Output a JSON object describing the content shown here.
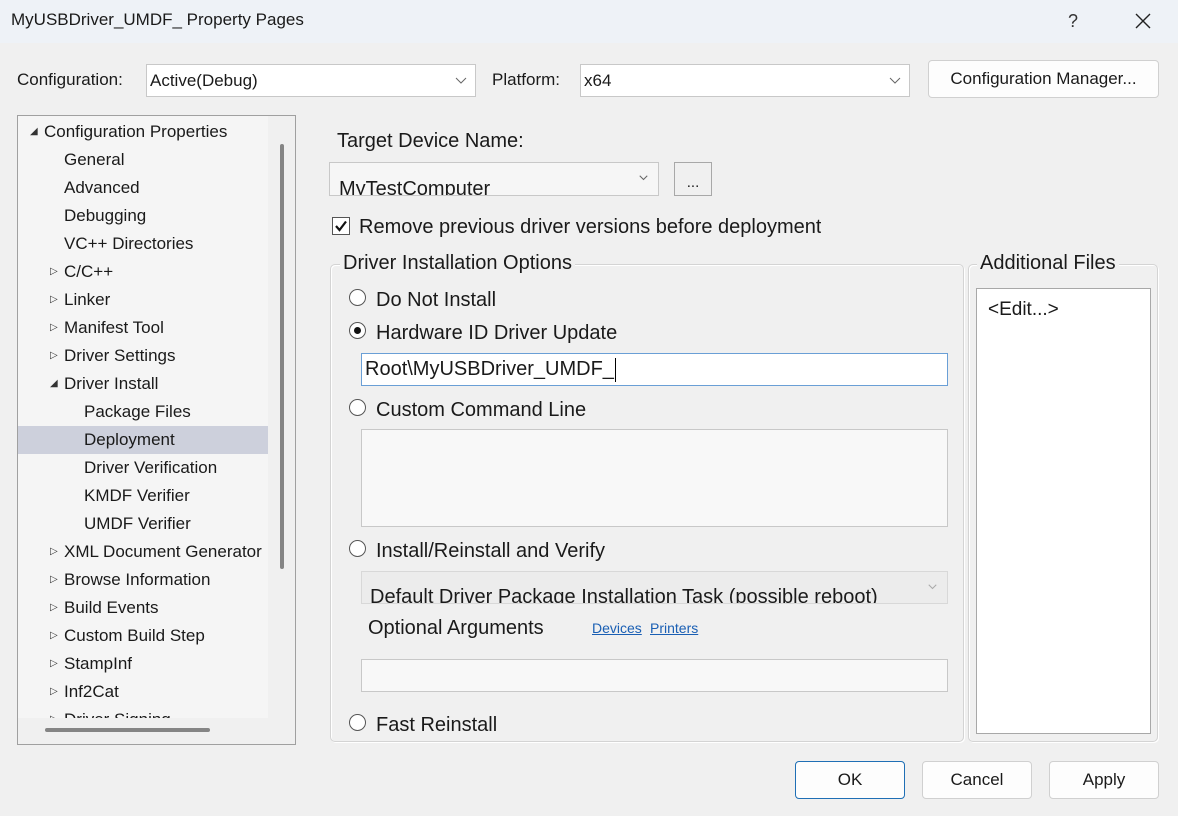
{
  "window": {
    "title": "MyUSBDriver_UMDF_ Property Pages",
    "help_label": "?"
  },
  "config_bar": {
    "configuration_label": "Configuration:",
    "configuration_value": "Active(Debug)",
    "platform_label": "Platform:",
    "platform_value": "x64",
    "config_manager_label": "Configuration Manager..."
  },
  "tree": {
    "items": [
      {
        "label": "Configuration Properties",
        "level": 0,
        "expander": "expanded"
      },
      {
        "label": "General",
        "level": 1,
        "expander": "none"
      },
      {
        "label": "Advanced",
        "level": 1,
        "expander": "none"
      },
      {
        "label": "Debugging",
        "level": 1,
        "expander": "none"
      },
      {
        "label": "VC++ Directories",
        "level": 1,
        "expander": "none"
      },
      {
        "label": "C/C++",
        "level": 1,
        "expander": "collapsed"
      },
      {
        "label": "Linker",
        "level": 1,
        "expander": "collapsed"
      },
      {
        "label": "Manifest Tool",
        "level": 1,
        "expander": "collapsed"
      },
      {
        "label": "Driver Settings",
        "level": 1,
        "expander": "collapsed"
      },
      {
        "label": "Driver Install",
        "level": 1,
        "expander": "expanded"
      },
      {
        "label": "Package Files",
        "level": 2,
        "expander": "none"
      },
      {
        "label": "Deployment",
        "level": 2,
        "expander": "none",
        "selected": true
      },
      {
        "label": "Driver Verification",
        "level": 2,
        "expander": "none"
      },
      {
        "label": "KMDF Verifier",
        "level": 2,
        "expander": "none"
      },
      {
        "label": "UMDF Verifier",
        "level": 2,
        "expander": "none"
      },
      {
        "label": "XML Document Generator",
        "level": 1,
        "expander": "collapsed"
      },
      {
        "label": "Browse Information",
        "level": 1,
        "expander": "collapsed"
      },
      {
        "label": "Build Events",
        "level": 1,
        "expander": "collapsed"
      },
      {
        "label": "Custom Build Step",
        "level": 1,
        "expander": "collapsed"
      },
      {
        "label": "StampInf",
        "level": 1,
        "expander": "collapsed"
      },
      {
        "label": "Inf2Cat",
        "level": 1,
        "expander": "collapsed"
      },
      {
        "label": "Driver Signing",
        "level": 1,
        "expander": "collapsed"
      }
    ]
  },
  "deployment": {
    "target_device_label": "Target Device Name:",
    "target_device_value": "MyTestComputer",
    "browse_label": "...",
    "remove_previous_label": "Remove previous driver versions before deployment",
    "remove_previous_checked": true,
    "install_options": {
      "title": "Driver Installation Options",
      "do_not_install": "Do Not Install",
      "hardware_id_update": "Hardware ID Driver Update",
      "hardware_id_value": "Root\\MyUSBDriver_UMDF_",
      "custom_command_line": "Custom Command Line",
      "custom_command_value": "",
      "install_reinstall_verify": "Install/Reinstall and Verify",
      "task_value": "Default Driver Package Installation Task (possible reboot)",
      "optional_args_label": "Optional Arguments",
      "devices_link": "Devices",
      "printers_link": "Printers",
      "optional_args_value": "",
      "fast_reinstall": "Fast Reinstall",
      "selected": "hardware_id_update"
    },
    "additional_files": {
      "title": "Additional Files",
      "edit_label": "<Edit...>"
    }
  },
  "footer": {
    "ok_label": "OK",
    "cancel_label": "Cancel",
    "apply_label": "Apply"
  }
}
